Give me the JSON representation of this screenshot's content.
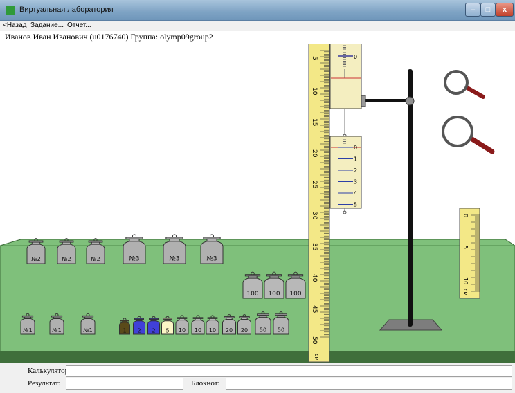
{
  "window": {
    "title": "Виртуальная лаборатория",
    "controls": {
      "minimize": "–",
      "maximize": "□",
      "close": "x"
    }
  },
  "menu": {
    "back": "<Назад",
    "task": "Задание...",
    "report": "Отчет..."
  },
  "user": {
    "info": "Иванов Иван Иванович (u0176740)  Группа: olymp09group2"
  },
  "ruler_main": {
    "labels": [
      "5",
      "10",
      "15",
      "20",
      "25",
      "30",
      "35",
      "40",
      "45",
      "50"
    ],
    "unit": "см"
  },
  "dynamometer_upper": {
    "labels": [
      "0"
    ]
  },
  "dynamometer_lower": {
    "labels": [
      "0",
      "1",
      "2",
      "3",
      "4",
      "5"
    ]
  },
  "ruler_small": {
    "labels": [
      "0",
      "5",
      "10"
    ],
    "unit": "см"
  },
  "weights_large": [
    "№2",
    "№2",
    "№2",
    "№3",
    "№3",
    "№3"
  ],
  "weights_100": [
    "100",
    "100",
    "100"
  ],
  "weights_small": [
    "№1",
    "№1",
    "№1",
    "1",
    "2",
    "2",
    "5",
    "10",
    "10",
    "10",
    "20",
    "20",
    "50",
    "50"
  ],
  "bottom": {
    "calculator_label": "Калькулятор:",
    "calculator_value": "",
    "result_label": "Результат:",
    "result_value": "",
    "notepad_label": "Блокнот:",
    "notepad_value": ""
  }
}
